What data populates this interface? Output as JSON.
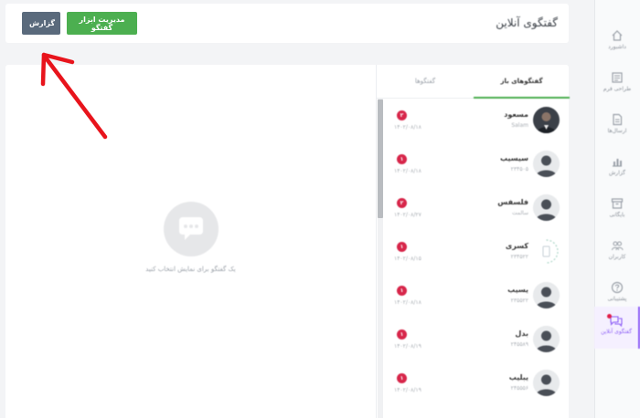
{
  "header": {
    "title": "گفتگوی آنلاین",
    "report_button": "گزارش",
    "manage_button": "مدیریت ابزار گفتگو"
  },
  "tabs": {
    "open_label": "گفتگوهای باز",
    "all_label": "گفتگوها"
  },
  "empty_state": {
    "icon": "chat-bubble-icon",
    "text": "یک گفتگو برای نمایش انتخاب کنید"
  },
  "sidebar": {
    "items": [
      {
        "label": "داشبورد",
        "icon": "home-icon"
      },
      {
        "label": "طراحی فرم",
        "icon": "form-icon"
      },
      {
        "label": "ارسال‌ها",
        "icon": "document-icon"
      },
      {
        "label": "گزارش",
        "icon": "chart-icon"
      },
      {
        "label": "بایگانی",
        "icon": "archive-icon"
      },
      {
        "label": "کاربران",
        "icon": "users-icon"
      },
      {
        "label": "پشتیبانی",
        "icon": "help-icon"
      },
      {
        "label": "گفتگوی آنلاین",
        "icon": "chat-icon",
        "active": true
      }
    ]
  },
  "conversations": [
    {
      "name": "مسعود",
      "sub": "Salam",
      "count": "۲",
      "date": "۱۴۰۲/۰۸/۱۸"
    },
    {
      "name": "سیسیب",
      "sub": "۲۳۴۵۰۵",
      "count": "۱",
      "date": "۱۴۰۲/۰۸/۱۸"
    },
    {
      "name": "فلسفس",
      "sub": "سالمت",
      "count": "۲",
      "date": "۱۴۰۲/۰۸/۲۷"
    },
    {
      "name": "کسری",
      "sub": "۲۳۴۵۲۲",
      "count": "۱",
      "date": "۱۴۰۲/۰۸/۱۵"
    },
    {
      "name": "یسیب",
      "sub": "۲۳۵۵۲۲",
      "count": "۱",
      "date": "۱۴۰۲/۰۸/۱۸"
    },
    {
      "name": "بدل",
      "sub": "۲۴۵۵۸۹",
      "count": "۱",
      "date": "۱۴۰۲/۰۸/۱۹"
    },
    {
      "name": "یبلیب",
      "sub": "۲۴۵۵۵۶",
      "count": "۱",
      "date": "۱۴۰۲/۰۸/۱۹"
    }
  ],
  "colors": {
    "accent_green": "#4caf50",
    "report_button": "#5a6a7c",
    "badge_red": "#d7264a",
    "active_nav": "#8b5cf6",
    "annotation_arrow": "#e8141c"
  }
}
